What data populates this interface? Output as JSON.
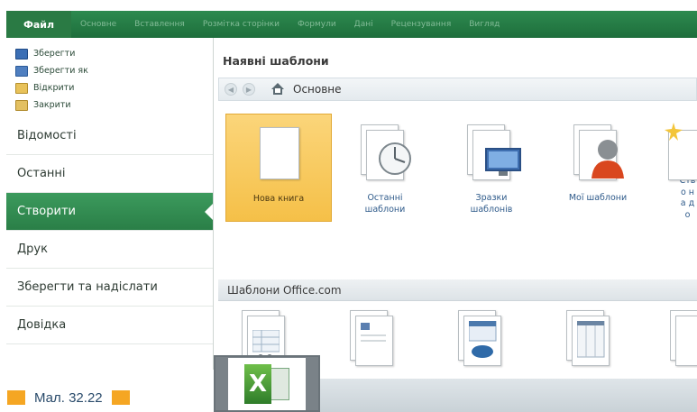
{
  "ribbon": {
    "file_tab": "Файл",
    "tabs": [
      "Основне",
      "Вставлення",
      "Розмітка сторінки",
      "Формули",
      "Дані",
      "Рецензування",
      "Вигляд"
    ]
  },
  "nav": {
    "small_items": [
      {
        "label": "Зберегти",
        "icon": "save-icon"
      },
      {
        "label": "Зберегти як",
        "icon": "save-as-icon"
      },
      {
        "label": "Відкрити",
        "icon": "open-folder-icon"
      },
      {
        "label": "Закрити",
        "icon": "close-folder-icon"
      }
    ],
    "big_items": [
      {
        "label": "Відомості"
      },
      {
        "label": "Останні"
      },
      {
        "label": "Створити",
        "active": true
      },
      {
        "label": "Друк"
      },
      {
        "label": "Зберегти та надіслати"
      },
      {
        "label": "Довідка"
      }
    ]
  },
  "main": {
    "title": "Наявні шаблони",
    "breadcrumb": "Основне",
    "templates": [
      {
        "label": "Нова книга",
        "icon": "blank-workbook-icon"
      },
      {
        "label": "Останні шаблони",
        "icon": "recent-templates-icon"
      },
      {
        "label": "Зразки шаблонів",
        "icon": "sample-templates-icon"
      },
      {
        "label": "Мої шаблони",
        "icon": "my-templates-icon"
      },
      {
        "label": "Ство на до",
        "icon": "new-from-existing-icon"
      }
    ],
    "officecom_title": "Шаблони Office.com"
  },
  "caption": {
    "text": "Мал. 32.22"
  },
  "colors": {
    "ribbon": "#1e6e3c",
    "active_nav": "#2a7f47",
    "selected_tile": "#f5c048",
    "caption_square": "#f5a623"
  }
}
